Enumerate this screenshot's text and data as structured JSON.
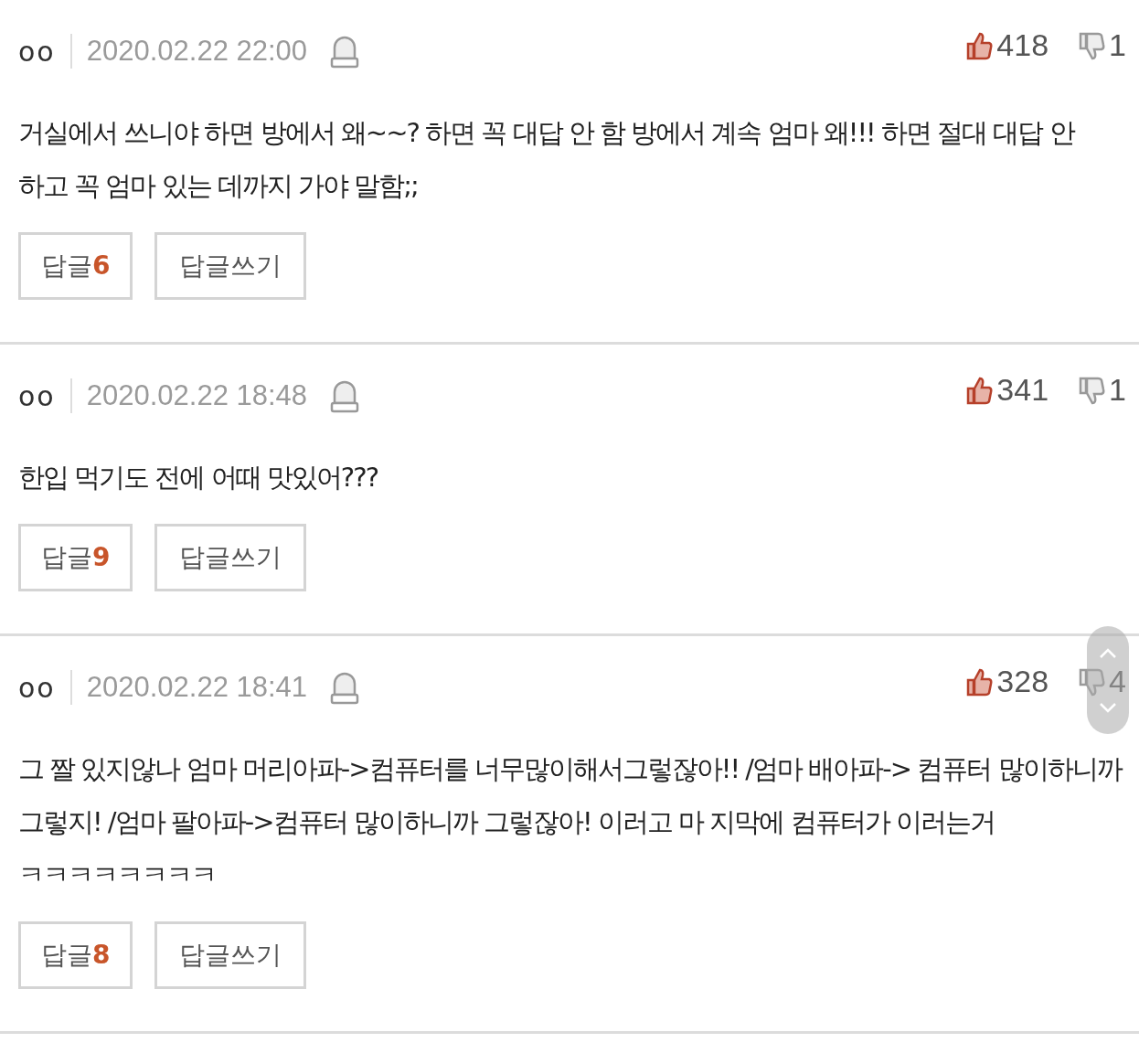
{
  "comments": [
    {
      "author": "oo",
      "date": "2020.02.22 22:00",
      "likes": "418",
      "dislikes": "1",
      "text": "거실에서 쓰니야 하면 방에서 왜~~? 하면 꼭 대답 안 함 방에서 계속 엄마 왜!!! 하면 절대 대답 안 하고 꼭 엄마 있는 데까지 가야 말함;;",
      "reply_label": "답글",
      "reply_count": "6",
      "write_label": "답글쓰기"
    },
    {
      "author": "oo",
      "date": "2020.02.22 18:48",
      "likes": "341",
      "dislikes": "1",
      "text": "한입 먹기도 전에 어때 맛있어???",
      "reply_label": "답글",
      "reply_count": "9",
      "write_label": "답글쓰기"
    },
    {
      "author": "oo",
      "date": "2020.02.22 18:41",
      "likes": "328",
      "dislikes": "4",
      "text": "그 짤 있지않나 엄마 머리아파->컴퓨터를 너무많이해서그렇잖아!! /엄마 배아파-> 컴퓨터 많이하니까 그렇지! /엄마 팔아파->컴퓨터 많이하니까 그렇잖아! 이러고 마 지막에 컴퓨터가 이러는거 ㅋㅋㅋㅋㅋㅋㅋㅋ",
      "reply_label": "답글",
      "reply_count": "8",
      "write_label": "답글쓰기"
    }
  ]
}
